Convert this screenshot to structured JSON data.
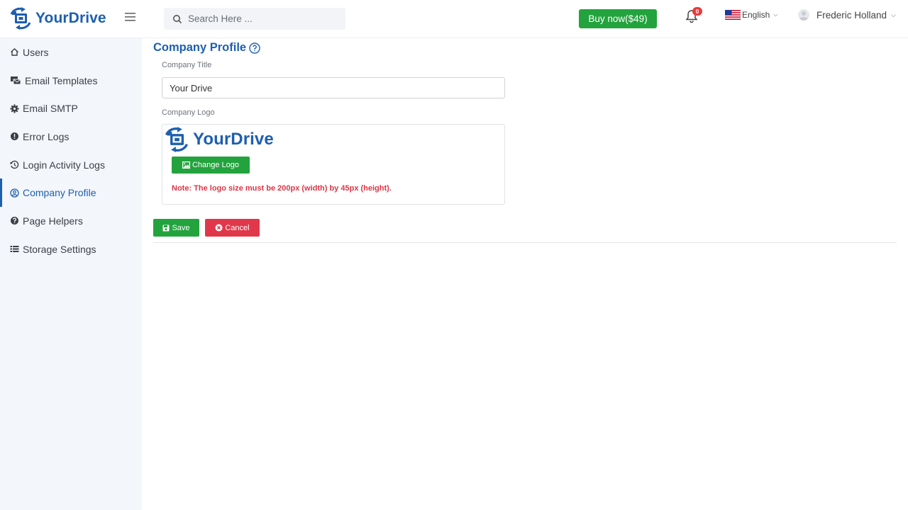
{
  "header": {
    "brand": "YourDrive",
    "search_placeholder": "Search Here ...",
    "buy_label": "Buy now($49)",
    "notification_count": "0",
    "language": "English",
    "user_name": "Frederic Holland"
  },
  "sidebar": {
    "items": [
      {
        "label": "Users",
        "icon": "home-icon"
      },
      {
        "label": "Email Templates",
        "icon": "email-template-icon"
      },
      {
        "label": "Email SMTP",
        "icon": "gear-icon"
      },
      {
        "label": "Error Logs",
        "icon": "exclamation-circle-icon"
      },
      {
        "label": "Login Activity Logs",
        "icon": "history-icon"
      },
      {
        "label": "Company Profile",
        "icon": "user-circle-icon",
        "active": true
      },
      {
        "label": "Page Helpers",
        "icon": "question-circle-icon"
      },
      {
        "label": "Storage Settings",
        "icon": "list-icon"
      }
    ]
  },
  "main": {
    "title": "Company Profile",
    "company_title_label": "Company Title",
    "company_title_value": "Your Drive",
    "company_logo_label": "Company Logo",
    "logo_preview_text": "YourDrive",
    "change_logo_label": "Change Logo",
    "note": "Note: The logo size must be 200px (width) by 45px (height).",
    "save_label": "Save",
    "cancel_label": "Cancel"
  },
  "colors": {
    "brand": "#1d5fb0",
    "success": "#23a33d",
    "danger": "#e0384a",
    "sidebar_bg": "#f3f6fb"
  }
}
